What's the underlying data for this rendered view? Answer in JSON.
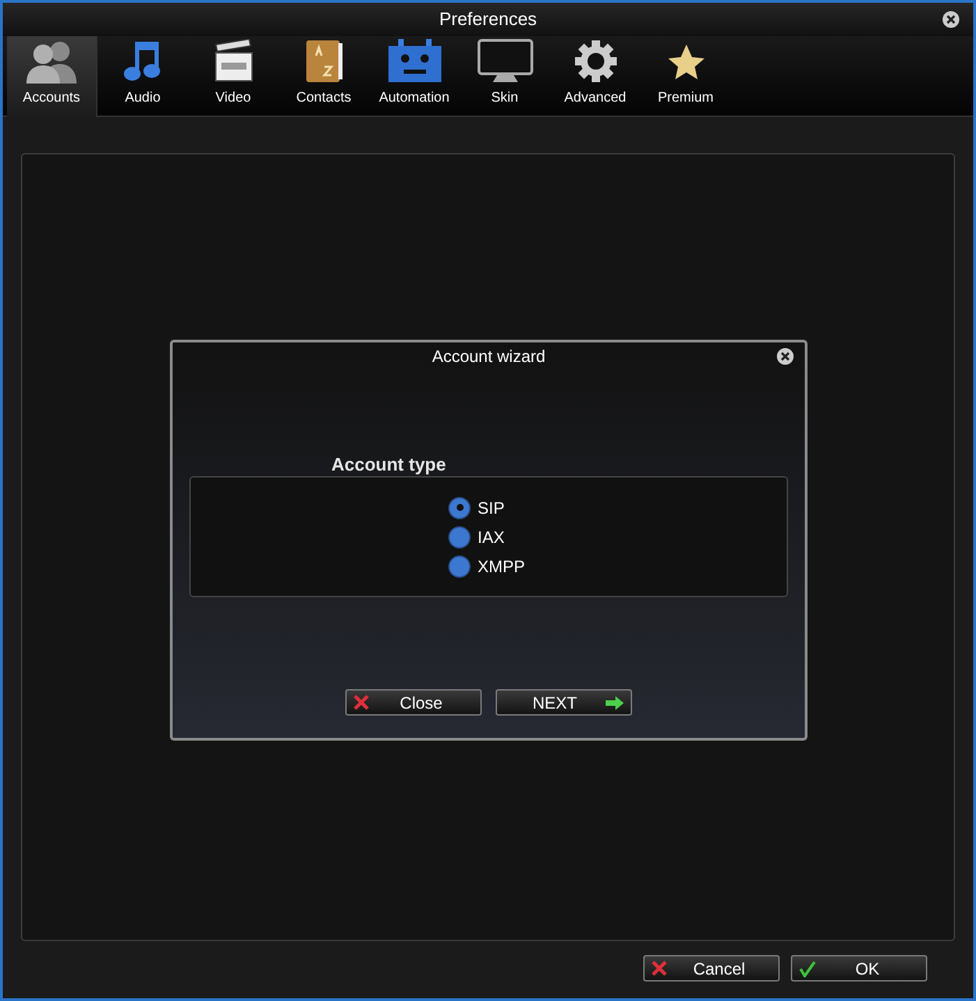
{
  "window": {
    "title": "Preferences"
  },
  "tabs": [
    {
      "label": "Accounts",
      "selected": true
    },
    {
      "label": "Audio",
      "selected": false
    },
    {
      "label": "Video",
      "selected": false
    },
    {
      "label": "Contacts",
      "selected": false
    },
    {
      "label": "Automation",
      "selected": false
    },
    {
      "label": "Skin",
      "selected": false
    },
    {
      "label": "Advanced",
      "selected": false
    },
    {
      "label": "Premium",
      "selected": false
    }
  ],
  "dialog": {
    "title": "Account wizard",
    "section_label": "Account type",
    "options": [
      {
        "label": "SIP",
        "selected": true
      },
      {
        "label": "IAX",
        "selected": false
      },
      {
        "label": "XMPP",
        "selected": false
      }
    ],
    "buttons": [
      {
        "label": "Close",
        "kind": "close"
      },
      {
        "label": "NEXT",
        "kind": "next"
      }
    ]
  },
  "buttons": [
    {
      "label": "Cancel",
      "kind": "cancel"
    },
    {
      "label": "OK",
      "kind": "ok"
    }
  ]
}
